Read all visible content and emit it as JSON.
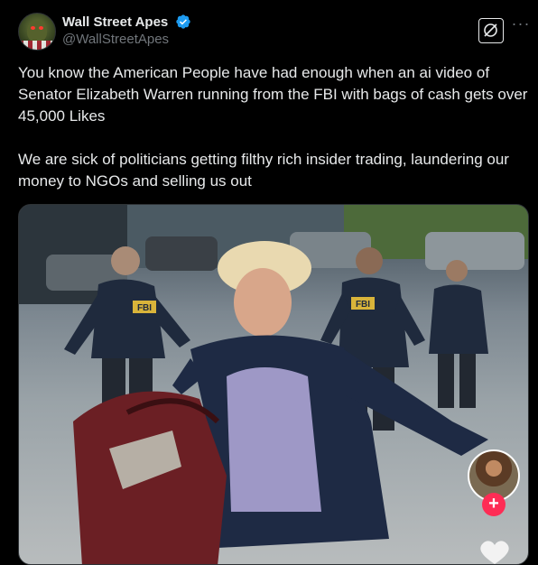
{
  "author": {
    "display_name": "Wall Street Apes",
    "handle": "@WallStreetApes",
    "avatar_icon": "ape-avatar",
    "verified_icon": "verified-badge-icon"
  },
  "actions": {
    "grok_icon": "grok-icon",
    "more_label": "···"
  },
  "post": {
    "text": "You know the American People have had enough when an ai video of Senator Elizabeth Warren running from the FBI with bags of cash gets over 45,000 Likes\n\nWe are sick of politicians getting filthy rich insider trading, laundering our money to NGOs and selling us out"
  },
  "media": {
    "agent_badge_1": "FBI",
    "agent_badge_2": "FBI",
    "follow_label": "+"
  },
  "colors": {
    "background": "#000000",
    "text": "#e7e9ea",
    "secondary_text": "#71767b",
    "verified": "#1d9bf0",
    "follow": "#fe2c55"
  }
}
